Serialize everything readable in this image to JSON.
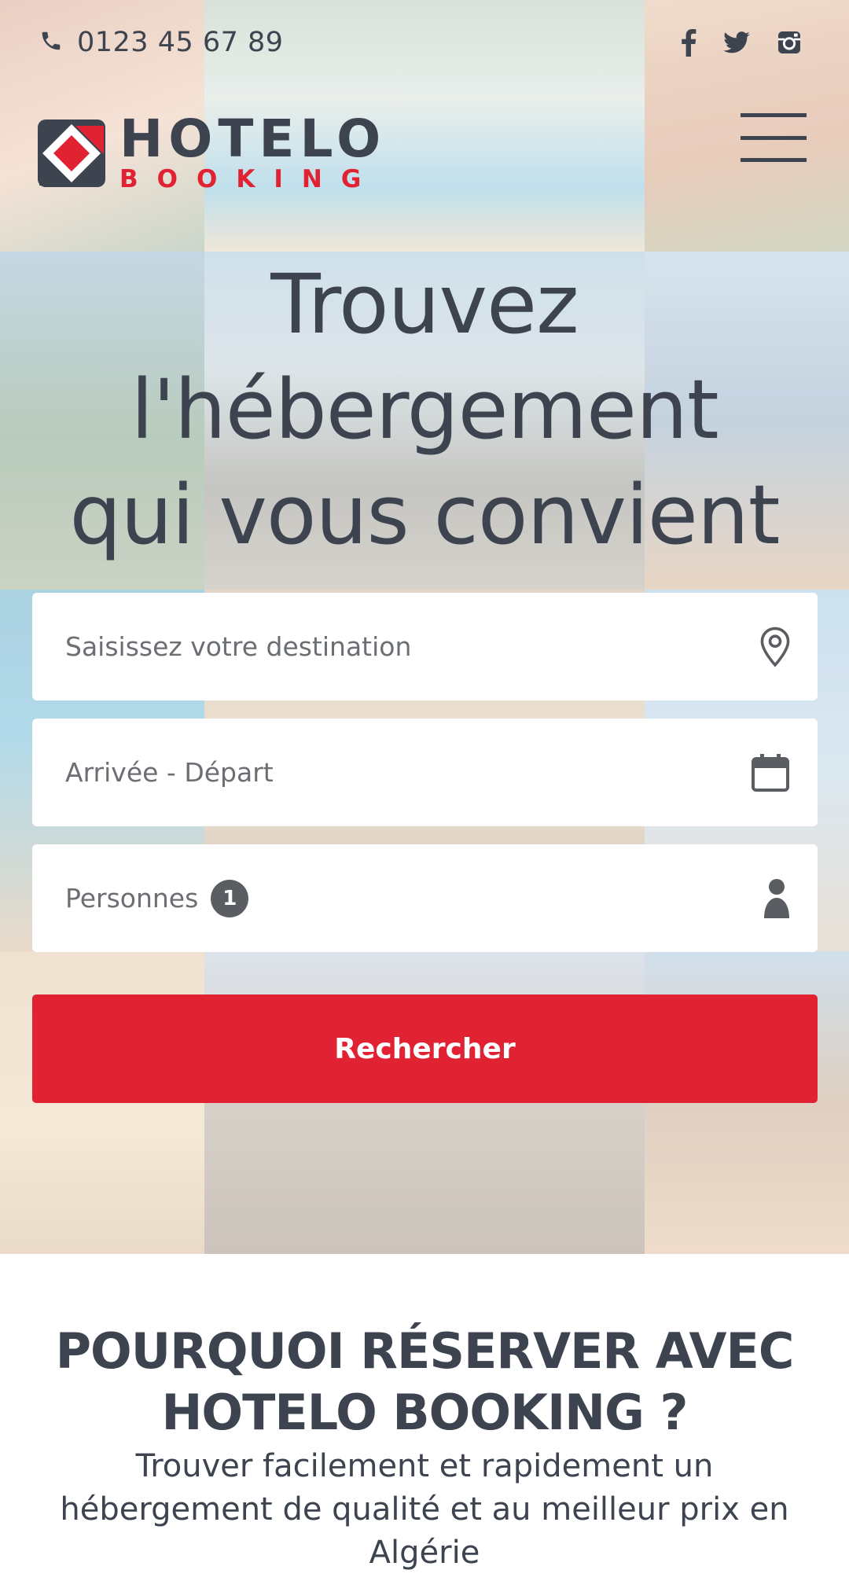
{
  "topbar": {
    "phone": "0123 45 67 89",
    "social": [
      {
        "icon": "facebook-icon"
      },
      {
        "icon": "twitter-icon"
      },
      {
        "icon": "instagram-icon"
      }
    ]
  },
  "logo": {
    "line1": "HOTELO",
    "line2": "BOOKING",
    "colors": {
      "dark": "#3d4450",
      "red": "#e02233"
    }
  },
  "menu": {
    "icon": "hamburger-menu-icon"
  },
  "hero": {
    "line1": "Trouvez",
    "line2": "l'hébergement",
    "line3": "qui vous convient"
  },
  "search": {
    "destination_placeholder": "Saisissez votre destination",
    "dates_placeholder": "Arrivée - Départ",
    "persons_label": "Personnes",
    "persons_count": "1",
    "button_label": "Rechercher"
  },
  "why": {
    "title": "POURQUOI RÉSERVER AVEC HOTELO BOOKING ?",
    "subtitle": "Trouver facilement et rapidement un hébergement de qualité et au meilleur prix en Algérie"
  },
  "theme": {
    "accent": "#e02233",
    "text": "#3d4450",
    "muted": "#6b6e73"
  }
}
